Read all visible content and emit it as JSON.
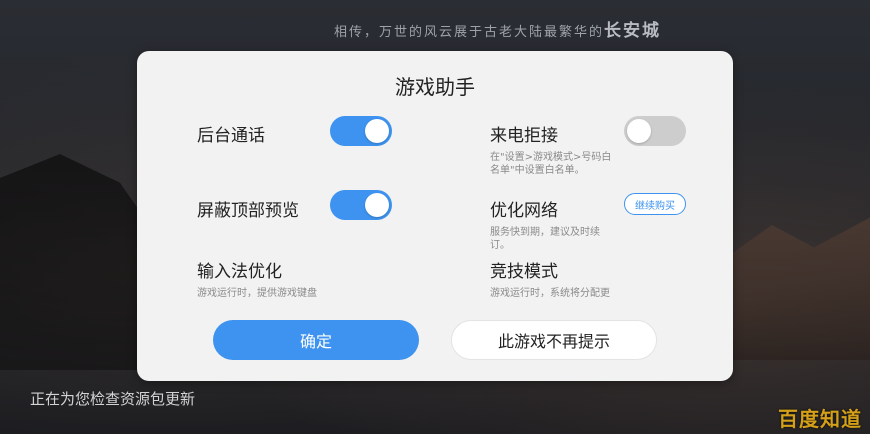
{
  "background": {
    "status_text": "正在为您检查资源包更新",
    "tagline": "相传，万世的风云展于古老大陆最繁华的",
    "tagline_city": "长安城",
    "watermark": "百度知道"
  },
  "dialog": {
    "title": "游戏助手",
    "options": [
      {
        "label": "后台通话",
        "desc": "",
        "toggle": "on"
      },
      {
        "label": "来电拒接",
        "desc": "在\"设置>游戏模式>号码白名单\"中设置白名单。",
        "toggle": "off"
      },
      {
        "label": "屏蔽顶部预览",
        "desc": "",
        "toggle": "on"
      },
      {
        "label": "优化网络",
        "desc": "服务快到期，建议及时续订。",
        "action": "继续购买"
      },
      {
        "label": "输入法优化",
        "desc": "游戏运行时，提供游戏键盘"
      },
      {
        "label": "竞技模式",
        "desc": "游戏运行时，系统将分配更"
      }
    ],
    "confirm_label": "确定",
    "never_label": "此游戏不再提示"
  },
  "colors": {
    "accent": "#3d93ef",
    "toggle_off": "#cdcdcd",
    "dialog_bg": "#f2f2f2"
  }
}
